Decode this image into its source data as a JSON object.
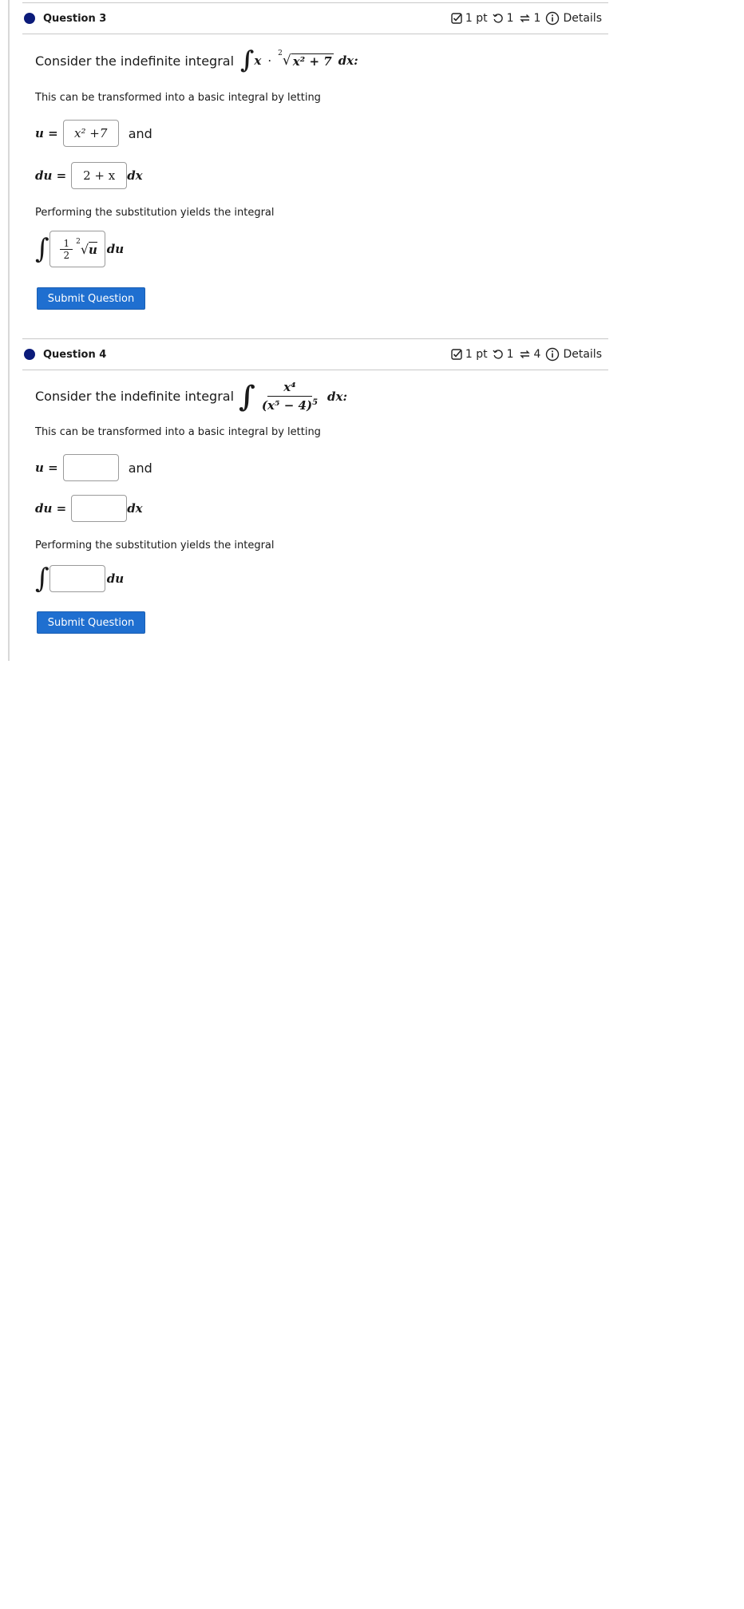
{
  "questions": [
    {
      "title": "Question 3",
      "meta": {
        "points": "1 pt",
        "retries": "1",
        "attempts": "1",
        "details": "Details"
      },
      "prompt": "Consider the indefinite integral",
      "integrand": {
        "factor": "x",
        "dot": "·",
        "root_index": "2",
        "radicand": "x² + 7",
        "dx": "dx:"
      },
      "transform_text": "This can be transformed into a basic integral by letting",
      "u_label": "u =",
      "u_value": "x² +7",
      "and_label": "and",
      "du_label": "du =",
      "du_value": "2 + x",
      "dx_label": "dx",
      "performing_text": "Performing the substitution yields the integral",
      "result_value": {
        "num": "1",
        "den": "2",
        "root_index": "2",
        "radicand": "u"
      },
      "du_suffix": "du",
      "submit_label": "Submit Question"
    },
    {
      "title": "Question 4",
      "meta": {
        "points": "1 pt",
        "retries": "1",
        "attempts": "4",
        "details": "Details"
      },
      "prompt": "Consider the indefinite integral",
      "integrand": {
        "numerator": "x⁴",
        "denominator_base": "(x⁵ − 4)",
        "denominator_power": "5",
        "dx": "dx:"
      },
      "transform_text": "This can be transformed into a basic integral by letting",
      "u_label": "u =",
      "u_value": "",
      "and_label": "and",
      "du_label": "du =",
      "du_value": "",
      "dx_label": "dx",
      "performing_text": "Performing the substitution yields the integral",
      "result_value": "",
      "du_suffix": "du",
      "submit_label": "Submit Question"
    }
  ],
  "colors": {
    "status_dot": "#0b1b7a",
    "button": "#1f6fd0"
  }
}
